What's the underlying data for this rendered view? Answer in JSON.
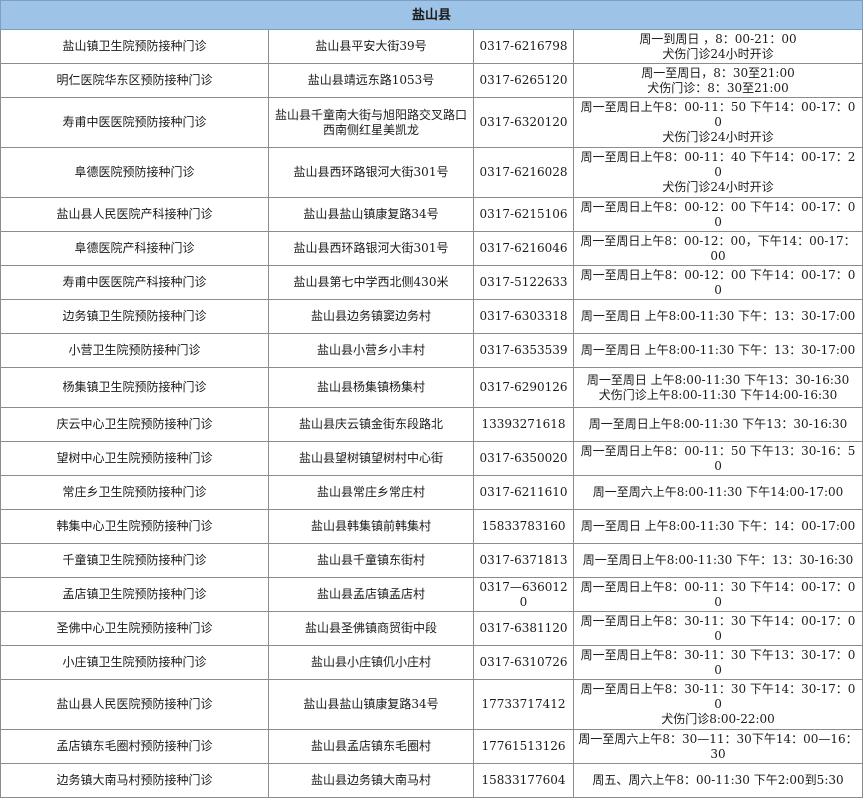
{
  "region_title": "盐山县",
  "rows": [
    {
      "name": "盐山镇卫生院预防接种门诊",
      "address": "盐山县平安大街39号",
      "phone": "0317-6216798",
      "hours": "周一到周日 ，8：00-21：00\n犬伤门诊24小时开诊"
    },
    {
      "name": "明仁医院华东区预防接种门诊",
      "address": "盐山县靖远东路1053号",
      "phone": "0317-6265120",
      "hours": "周一至周日，8：30至21:00\n犬伤门诊：8：30至21:00"
    },
    {
      "name": "寿甫中医医院预防接种门诊",
      "address": "盐山县千童南大街与旭阳路交叉路口西南侧红星美凯龙",
      "phone": "0317-6320120",
      "hours": "周一至周日上午8：00-11：50    下午14：00-17：00\n犬伤门诊24小时开诊"
    },
    {
      "name": "阜德医院预防接种门诊",
      "address": "盐山县西环路银河大街301号",
      "phone": "0317-6216028",
      "hours": "周一至周日上午8：00-11：40    下午14：00-17：20\n犬伤门诊24小时开诊"
    },
    {
      "name": "盐山县人民医院产科接种门诊",
      "address": "盐山县盐山镇康复路34号",
      "phone": "0317-6215106",
      "hours": "周一至周日上午8：00-12：00    下午14：00-17：00"
    },
    {
      "name": "阜德医院产科接种门诊",
      "address": "盐山县西环路银河大街301号",
      "phone": "0317-6216046",
      "hours": "周一至周日上午8：00-12：00，下午14：00-17：00"
    },
    {
      "name": "寿甫中医医院产科接种门诊",
      "address": "盐山县第七中学西北侧430米",
      "phone": "0317-5122633",
      "hours": "周一至周日上午8：00-12：00    下午14：00-17：00"
    },
    {
      "name": "边务镇卫生院预防接种门诊",
      "address": "盐山县边务镇窦边务村",
      "phone": "0317-6303318",
      "hours": "周一至周日 上午8:00-11:30    下午：13：30-17:00"
    },
    {
      "name": "小营卫生院预防接种门诊",
      "address": "盐山县小营乡小丰村",
      "phone": "0317-6353539",
      "hours": "周一至周日 上午8:00-11:30    下午：13：30-17:00"
    },
    {
      "name": "杨集镇卫生院预防接种门诊",
      "address": "盐山县杨集镇杨集村",
      "phone": "0317-6290126",
      "hours": "周一至周日 上午8:00-11:30    下午13：30-16:30\n犬伤门诊上午8:00-11:30 下午14:00-16:30"
    },
    {
      "name": "庆云中心卫生院预防接种门诊",
      "address": "盐山县庆云镇金街东段路北",
      "phone": "13393271618",
      "hours": "周一至周日上午8:00-11:30    下午13：30-16:30"
    },
    {
      "name": "望树中心卫生院预防接种门诊",
      "address": "盐山县望树镇望树村中心街",
      "phone": "0317-6350020",
      "hours": "周一至周日上午8：00-11：50    下午13：30-16：50"
    },
    {
      "name": "常庄乡卫生院预防接种门诊",
      "address": "盐山县常庄乡常庄村",
      "phone": "0317-6211610",
      "hours": "周一至周六上午8:00-11:30  下午14:00-17:00"
    },
    {
      "name": "韩集中心卫生院预防接种门诊",
      "address": "盐山县韩集镇前韩集村",
      "phone": "15833783160",
      "hours": "周一至周日 上午8:00-11:30    下午：14：00-17:00"
    },
    {
      "name": "千童镇卫生院预防接种门诊",
      "address": "盐山县千童镇东街村",
      "phone": "0317-6371813",
      "hours": "周一至周日上午8:00-11:30    下午：13：30-16:30"
    },
    {
      "name": "孟店镇卫生院预防接种门诊",
      "address": "盐山县孟店镇孟店村",
      "phone": "0317—6360120",
      "hours": "周一至周日上午8：00-11：30    下午14：00-17：00"
    },
    {
      "name": "圣佛中心卫生院预防接种门诊",
      "address": "盐山县圣佛镇商贸街中段",
      "phone": "0317-6381120",
      "hours": "周一至周日上午8：30-11：30    下午14：00-17：00"
    },
    {
      "name": "小庄镇卫生院预防接种门诊",
      "address": "盐山县小庄镇仉小庄村",
      "phone": "0317-6310726",
      "hours": "周一至周日上午8：30-11：30    下午13：30-17：00"
    },
    {
      "name": "盐山县人民医院预防接种门诊",
      "address": "盐山县盐山镇康复路34号",
      "phone": "17733717412",
      "hours": "周一至周日上午8：30-11：30    下午14：30-17：00\n犬伤门诊8:00-22:00"
    },
    {
      "name": "孟店镇东毛圈村预防接种门诊",
      "address": "盐山县孟店镇东毛圈村",
      "phone": "17761513126",
      "hours": "周一至周六上午8：30—11：30下午14：00—16：30"
    },
    {
      "name": "边务镇大南马村预防接种门诊",
      "address": "盐山县边务镇大南马村",
      "phone": "15833177604",
      "hours": "周五、周六上午8：00-11:30   下午2:00到5:30"
    }
  ]
}
